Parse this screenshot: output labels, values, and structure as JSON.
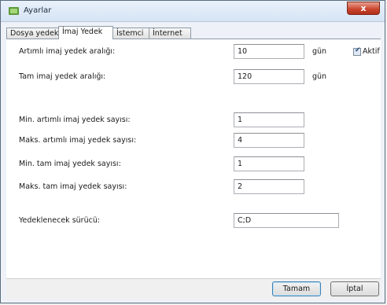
{
  "window": {
    "title": "Ayarlar",
    "close_label": "x"
  },
  "tabs": [
    {
      "label": "Dosya yedek",
      "active": false
    },
    {
      "label": "İmaj Yedek",
      "active": true
    },
    {
      "label": "İstemci",
      "active": false
    },
    {
      "label": "İnternet",
      "active": false
    }
  ],
  "form": {
    "artimli_aralik": {
      "label": "Artımlı imaj yedek aralığı:",
      "value": "10",
      "unit": "gün"
    },
    "aktif": {
      "label": "Aktif",
      "checked": true
    },
    "tam_aralik": {
      "label": "Tam imaj yedek aralığı:",
      "value": "120",
      "unit": "gün"
    },
    "min_artimli": {
      "label": "Min. artımlı imaj yedek sayısı:",
      "value": "1"
    },
    "maks_artimli": {
      "label": "Maks. artımlı imaj yedek sayısı:",
      "value": "4"
    },
    "min_tam": {
      "label": "Min. tam imaj yedek sayısı:",
      "value": "1"
    },
    "maks_tam": {
      "label": "Maks. tam imaj yedek sayısı:",
      "value": "2"
    },
    "surucu": {
      "label": "Yedeklenecek sürücü:",
      "value": "C;D"
    }
  },
  "buttons": {
    "ok": "Tamam",
    "cancel": "İptal"
  },
  "colors": {
    "close": "#c8432b",
    "accent": "#3c7fb1"
  }
}
